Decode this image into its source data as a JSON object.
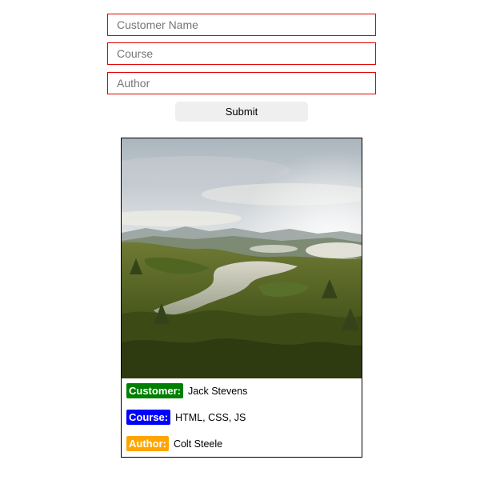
{
  "form": {
    "name_placeholder": "Customer Name",
    "course_placeholder": "Course",
    "author_placeholder": "Author",
    "submit_label": "Submit"
  },
  "card": {
    "image": "forest lake landscape photo",
    "customer_label": "Customer:",
    "customer_value": "Jack Stevens",
    "course_label": "Course:",
    "course_value": "HTML, CSS, JS",
    "author_label": "Author:",
    "author_value": "Colt Steele"
  },
  "colors": {
    "input_border": "#e00000",
    "customer_badge": "#008000",
    "course_badge": "#0000ff",
    "author_badge": "#ffa500",
    "submit_background": "#efefef"
  }
}
